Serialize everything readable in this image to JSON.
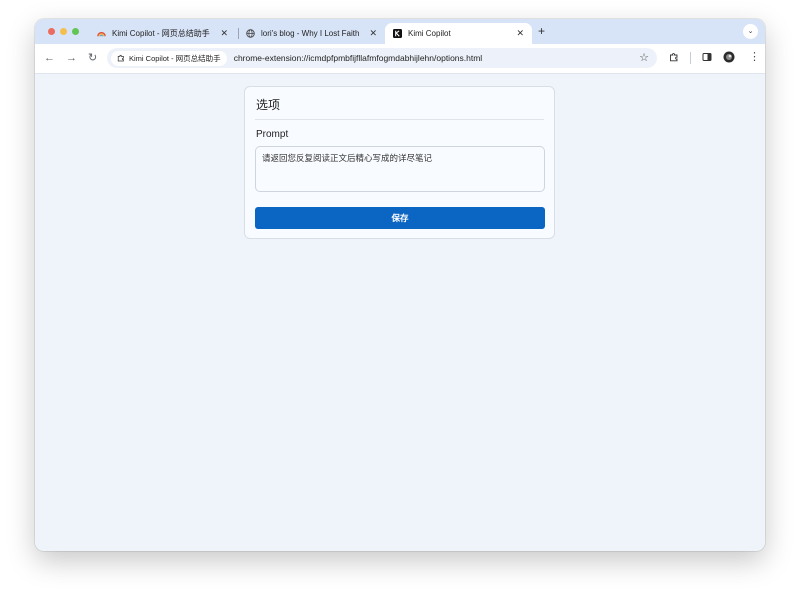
{
  "browser": {
    "tabs": [
      {
        "title": "Kimi Copilot - 网页总结助手",
        "active": false,
        "icon": "rainbow-icon"
      },
      {
        "title": "lori's blog - Why I Lost Faith",
        "active": false,
        "icon": "globe-icon"
      },
      {
        "title": "Kimi Copilot",
        "active": true,
        "icon": "kimi-k-icon"
      }
    ],
    "close_glyph": "✕",
    "new_tab_glyph": "+",
    "tab_menu_glyph": "⌄",
    "nav": {
      "back": "←",
      "forward": "→",
      "reload": "↻"
    },
    "site_chip": "Kimi Copilot - 网页总结助手",
    "url": "chrome-extension://icmdpfpmbfijfllafmfogmdabhijlehn/options.html",
    "star_glyph": "☆",
    "menu_glyph": "⋮"
  },
  "options": {
    "title": "选项",
    "prompt_label": "Prompt",
    "prompt_value": "请返回您反复阅读正文后精心写成的详尽笔记",
    "save_label": "保存"
  },
  "colors": {
    "accent": "#0b66c3",
    "tabstrip": "#d7e3f7",
    "page_bg": "#eff3fa"
  }
}
